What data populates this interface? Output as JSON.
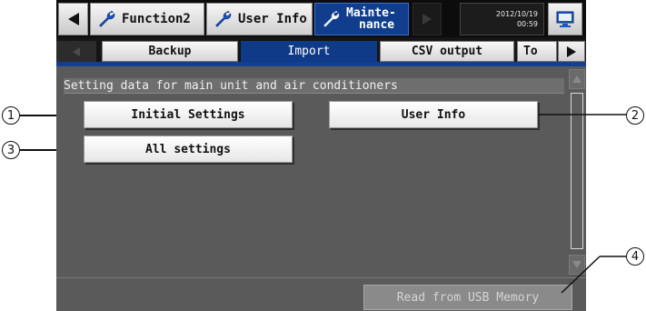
{
  "top_tabs": {
    "function2_label": "Function2",
    "user_info_label": "User Info",
    "maintenance_label_line1": "Mainte-",
    "maintenance_label_line2": "nance"
  },
  "datetime": {
    "date": "2012/10/19",
    "time": "00:59"
  },
  "sub_tabs": {
    "backup_label": "Backup",
    "import_label": "Import",
    "csv_output_label": "CSV output",
    "to_label": "To"
  },
  "content": {
    "section_header": "Setting data for main unit and air conditioners",
    "initial_settings_label": "Initial Settings",
    "user_info_label": "User Info",
    "all_settings_label": "All settings",
    "read_usb_label": "Read from USB Memory"
  },
  "callouts": {
    "c1": "1",
    "c2": "2",
    "c3": "3",
    "c4": "4"
  },
  "colors": {
    "screen_bg": "#5a5a5a",
    "active_tab": "#103d8c",
    "bar_bg": "#0c0c0c"
  }
}
